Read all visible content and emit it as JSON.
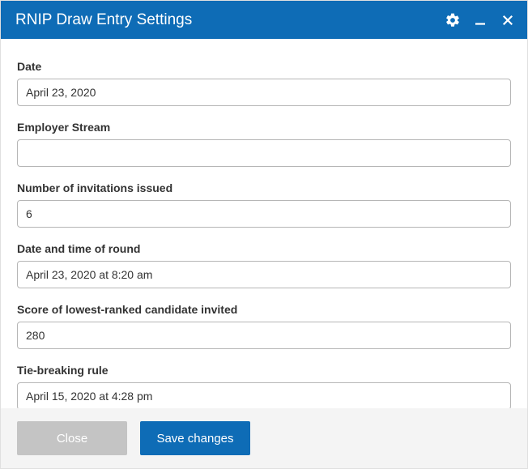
{
  "titlebar": {
    "title": "RNIP Draw Entry Settings"
  },
  "fields": {
    "date": {
      "label": "Date",
      "value": "April 23, 2020"
    },
    "employer_stream": {
      "label": "Employer Stream",
      "value": ""
    },
    "invitations": {
      "label": "Number of invitations issued",
      "value": "6"
    },
    "round_datetime": {
      "label": "Date and time of round",
      "value": "April 23, 2020 at 8:20 am"
    },
    "lowest_score": {
      "label": "Score of lowest-ranked candidate invited",
      "value": "280"
    },
    "tie_rule": {
      "label": "Tie-breaking rule",
      "value": "April 15, 2020 at 4:28 pm"
    }
  },
  "footer": {
    "close_label": "Close",
    "save_label": "Save changes"
  }
}
